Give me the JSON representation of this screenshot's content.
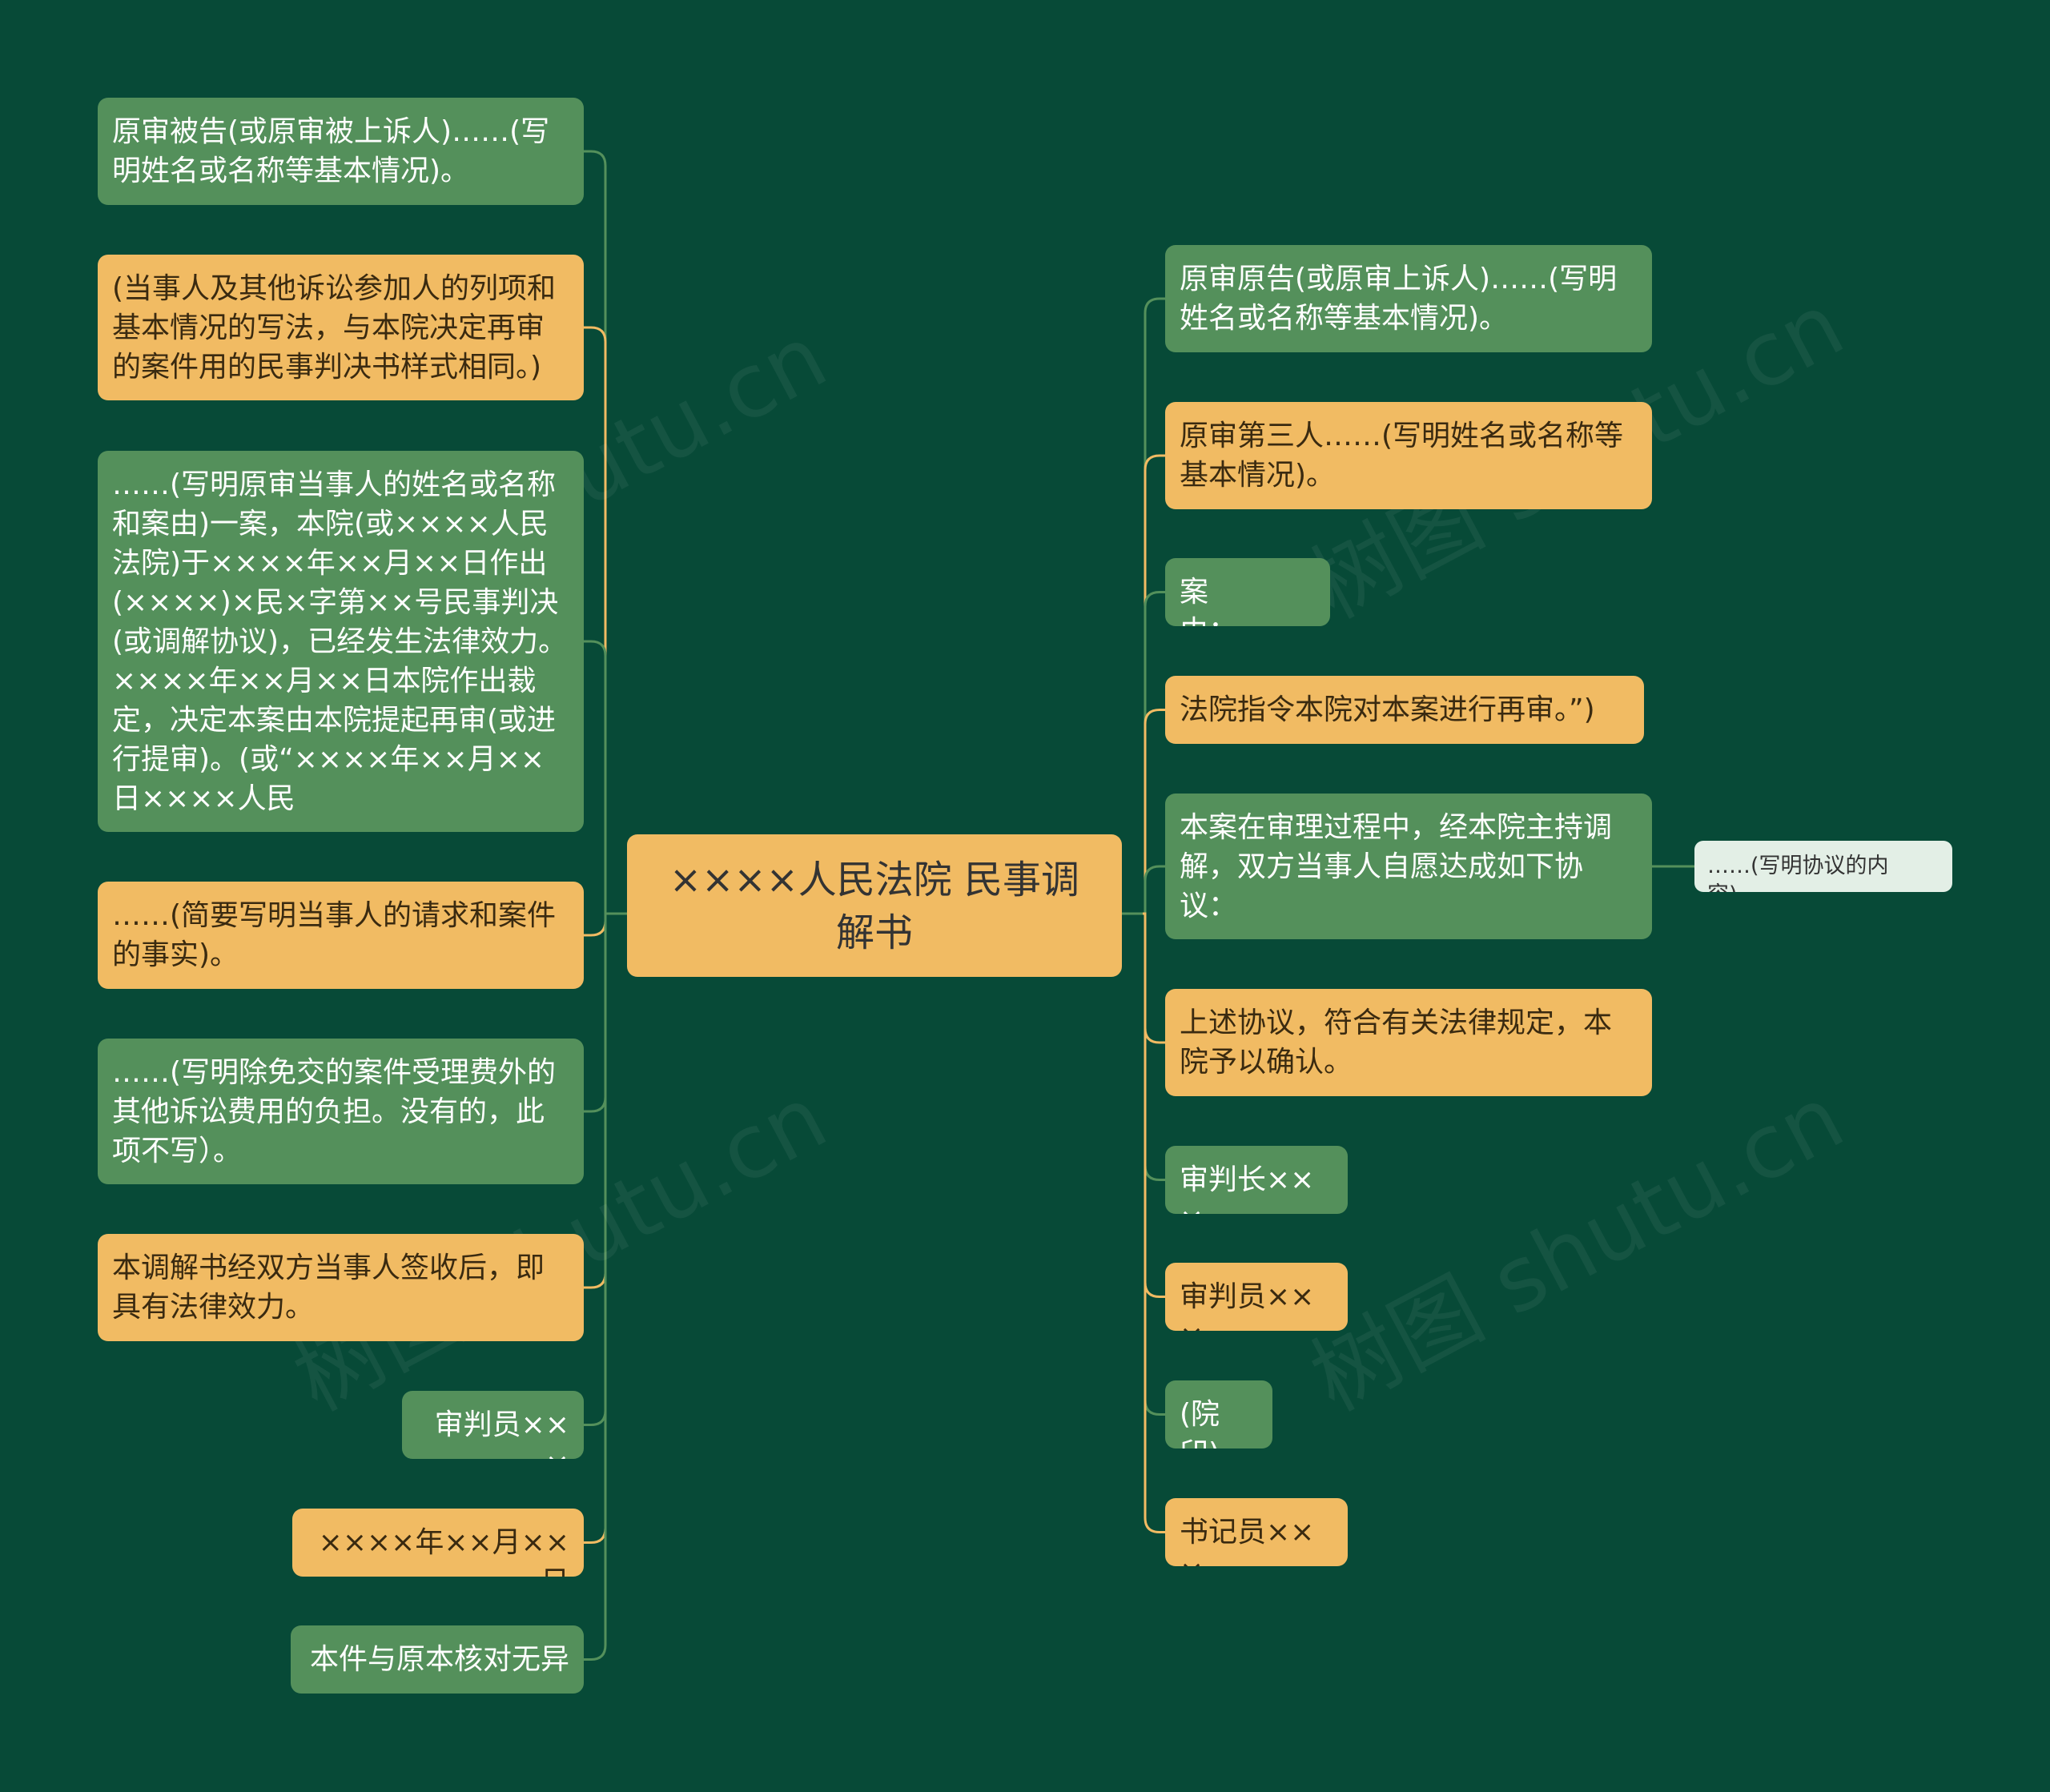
{
  "root": {
    "label": "××××人民法院 民事调解书"
  },
  "left_nodes": [
    {
      "label": "原审被告(或原审被上诉人)……(写明姓名或名称等基本情况)。",
      "color": "green"
    },
    {
      "label": "(当事人及其他诉讼参加人的列项和基本情况的写法，与本院决定再审的案件用的民事判决书样式相同。)",
      "color": "orange"
    },
    {
      "label": "……(写明原审当事人的姓名或名称和案由)一案，本院(或××××人民法院)于××××年××月××日作出(××××)×民×字第××号民事判决(或调解协议)，已经发生法律效力。××××年××月××日本院作出裁定，决定本案由本院提起再审(或进行提审)。(或“××××年××月××日××××人民",
      "color": "green"
    },
    {
      "label": "……(简要写明当事人的请求和案件的事实)。",
      "color": "orange"
    },
    {
      "label": "……(写明除免交的案件受理费外的其他诉讼费用的负担。没有的，此项不写）。",
      "color": "green"
    },
    {
      "label": "本调解书经双方当事人签收后，即具有法律效力。",
      "color": "orange"
    },
    {
      "label": "审判员×××",
      "color": "green"
    },
    {
      "label": "××××年××月××日",
      "color": "orange"
    },
    {
      "label": "本件与原本核对无异",
      "color": "green"
    }
  ],
  "right_nodes": [
    {
      "label": "原审原告(或原审上诉人)……(写明姓名或名称等基本情况)。",
      "color": "green"
    },
    {
      "label": "原审第三人……(写明姓名或名称等基本情况)。",
      "color": "orange"
    },
    {
      "label": "案由：……",
      "color": "green"
    },
    {
      "label": "法院指令本院对本案进行再审。”)",
      "color": "orange"
    },
    {
      "label": "本案在审理过程中，经本院主持调解，双方当事人自愿达成如下协议：",
      "color": "green"
    },
    {
      "label": "上述协议，符合有关法律规定，本院予以确认。",
      "color": "orange"
    },
    {
      "label": "审判长×××",
      "color": "green"
    },
    {
      "label": "审判员×××",
      "color": "orange"
    },
    {
      "label": "(院印)",
      "color": "green"
    },
    {
      "label": "书记员×××",
      "color": "orange"
    }
  ],
  "sub_node": {
    "label": "……(写明协议的内容)。",
    "parent": "right_nodes.4"
  },
  "watermark": "树图 shutu.cn",
  "colors": {
    "background": "#074a37",
    "green": "#54905b",
    "orange": "#f1bb63",
    "pale": "#e3efe6"
  }
}
